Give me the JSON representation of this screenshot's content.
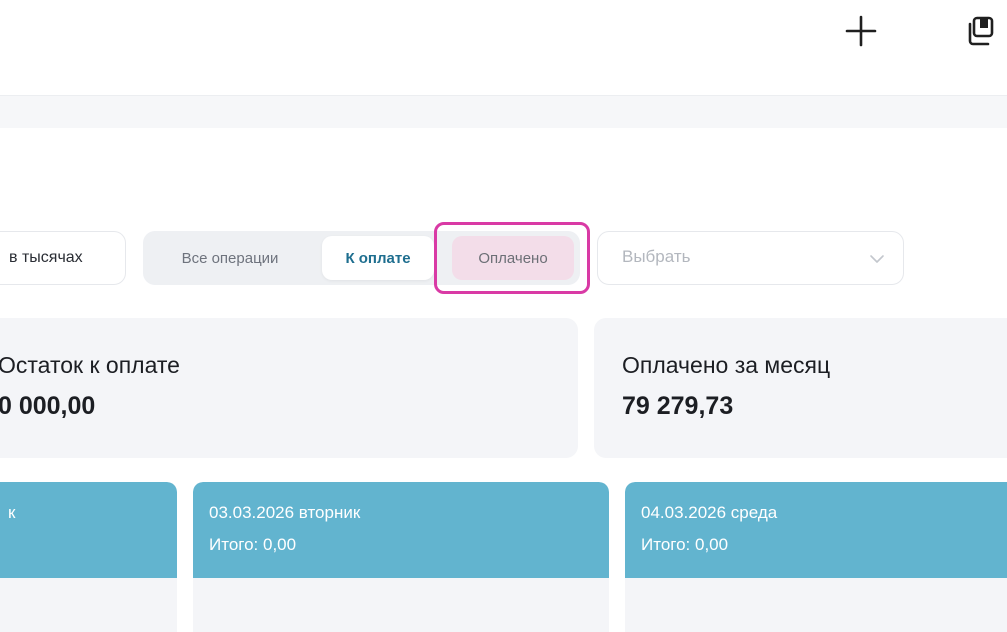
{
  "header": {
    "plus_icon": "plus-icon",
    "copy_icon": "copy-window-icon"
  },
  "filters": {
    "units_label": "в тысячах",
    "tabs": [
      {
        "label": "Все операции",
        "state": "inactive"
      },
      {
        "label": "К оплате",
        "state": "active"
      },
      {
        "label": "Оплачено",
        "state": "highlighted"
      }
    ],
    "select": {
      "placeholder": "Выбрать"
    },
    "highlight_color": "#d93aa5"
  },
  "summary": {
    "left": {
      "title": "Остаток к оплате",
      "value": "0 000,00"
    },
    "right": {
      "title": "Оплачено за месяц",
      "value": "79 279,73"
    }
  },
  "days": [
    {
      "date": "к",
      "total": ""
    },
    {
      "date": "03.03.2026 вторник",
      "total": "Итого: 0,00"
    },
    {
      "date": "04.03.2026 среда",
      "total": "Итого: 0,00"
    }
  ],
  "colors": {
    "day_header": "#62b4cf",
    "card_bg": "#f4f5f8",
    "active_tab_text": "#1e6e8f"
  }
}
